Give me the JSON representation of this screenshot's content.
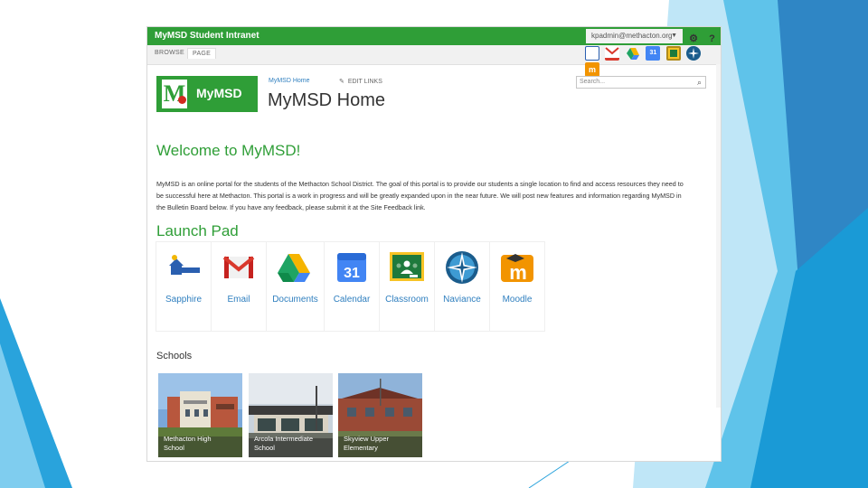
{
  "suite": {
    "title": "MyMSD Student Intranet",
    "user": "kpadmin@methacton.org",
    "settings_icon": "gear-icon",
    "help_label": "?"
  },
  "ribbon": {
    "tabs": [
      {
        "label": "BROWSE"
      },
      {
        "label": "PAGE"
      }
    ],
    "apps": [
      {
        "name": "sapphire-app-icon",
        "color": "#2a5fb0"
      },
      {
        "name": "gmail-app-icon",
        "color": "#d9382c"
      },
      {
        "name": "drive-app-icon",
        "color": "#1fa463"
      },
      {
        "name": "calendar-app-icon",
        "color": "#4285f4",
        "text": "31"
      },
      {
        "name": "classroom-app-icon",
        "color": "#1e7a3c"
      },
      {
        "name": "naviance-app-icon",
        "color": "#1a5c8c"
      },
      {
        "name": "moodle-app-icon",
        "color": "#f29400"
      }
    ]
  },
  "header": {
    "logo_text": "MyMSD",
    "logo_letter": "M",
    "breadcrumb": "MyMSD Home",
    "edit_links": "EDIT LINKS",
    "title": "MyMSD Home",
    "search_placeholder": "Search..."
  },
  "main": {
    "welcome": "Welcome to MyMSD!",
    "intro": "MyMSD is an online portal for the students of the Methacton School District. The goal of this portal is to provide our students a single location to find and access resources they need to be successful here at Methacton. This portal is a work in progress and will be greatly expanded upon in the near future. We will post new features and information regarding MyMSD in the Bulletin Board below. If you have any feedback, please submit it at the Site Feedback link.",
    "launchpad_title": "Launch Pad",
    "tiles": [
      {
        "label": "Sapphire",
        "icon": "sapphire-icon"
      },
      {
        "label": "Email",
        "icon": "gmail-icon"
      },
      {
        "label": "Documents",
        "icon": "google-drive-icon"
      },
      {
        "label": "Calendar",
        "icon": "calendar-icon",
        "text": "31"
      },
      {
        "label": "Classroom",
        "icon": "google-classroom-icon"
      },
      {
        "label": "Naviance",
        "icon": "naviance-compass-icon"
      },
      {
        "label": "Moodle",
        "icon": "moodle-icon"
      }
    ],
    "schools_title": "Schools",
    "schools": [
      {
        "name": "Methacton High School"
      },
      {
        "name": "Arcola Intermediate School"
      },
      {
        "name": "Skyview Upper Elementary"
      }
    ]
  },
  "colors": {
    "brand_green": "#2f9e37",
    "link_blue": "#2f7fbf",
    "slide_accent": "#29a3dc"
  }
}
